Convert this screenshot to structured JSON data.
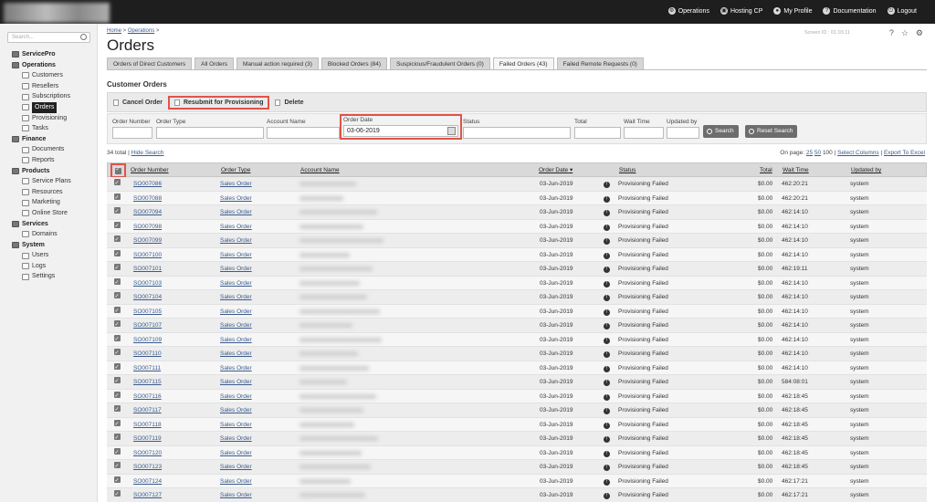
{
  "topnav": [
    {
      "label": "Operations",
      "icon": "operations-icon"
    },
    {
      "label": "Hosting CP",
      "icon": "hosting-cp-icon"
    },
    {
      "label": "My Profile",
      "icon": "profile-icon"
    },
    {
      "label": "Documentation",
      "icon": "help-icon"
    },
    {
      "label": "Logout",
      "icon": "power-icon"
    }
  ],
  "sidebar": {
    "search_placeholder": "Search...",
    "root": "ServicePro",
    "groups": [
      {
        "label": "Operations",
        "children": [
          "Customers",
          "Resellers",
          "Subscriptions",
          "Orders",
          "Provisioning",
          "Tasks"
        ]
      },
      {
        "label": "Finance",
        "children": [
          "Documents",
          "Reports"
        ]
      },
      {
        "label": "Products",
        "children": [
          "Service Plans",
          "Resources",
          "Marketing",
          "Online Store"
        ]
      },
      {
        "label": "Services",
        "children": [
          "Domains"
        ]
      },
      {
        "label": "System",
        "children": [
          "Users",
          "Logs",
          "Settings"
        ]
      }
    ],
    "active": "Orders"
  },
  "breadcrumb": {
    "home": "Home",
    "sep": " > ",
    "section": "Operations",
    "tail": " >"
  },
  "page": {
    "title": "Orders",
    "screen_id": "Screen ID : 01.03.11"
  },
  "tabs": [
    "Orders of Direct Customers",
    "All Orders",
    "Manual action required (3)",
    "Blocked Orders (84)",
    "Suspicious/Fraudulent Orders (0)",
    "Failed Orders (43)",
    "Failed Remote Requests (0)"
  ],
  "active_tab": "Failed Orders (43)",
  "section_title": "Customer Orders",
  "actions": {
    "cancel": "Cancel Order",
    "resubmit": "Resubmit for Provisioning",
    "delete": "Delete"
  },
  "filters": {
    "order_number": "Order Number",
    "order_type": "Order Type",
    "account_name": "Account Name",
    "order_date": "Order Date",
    "order_date_value": "03-06-2019",
    "status": "Status",
    "total": "Total",
    "wait_time": "Wait Time",
    "updated_by": "Updated by",
    "search_btn": "Search",
    "reset_btn": "Reset Search"
  },
  "listing": {
    "total": "34 total",
    "sep": " | ",
    "hide_search": "Hide Search",
    "on_page": "On page:",
    "page_25": "25",
    "page_50": "50",
    "page_100": "100",
    "select_columns": "Select Columns",
    "export": "Export To Excel"
  },
  "columns": {
    "order_number": "Order Number",
    "order_type": "Order Type",
    "account_name": "Account Name",
    "order_date": "Order Date",
    "status": "Status",
    "total": "Total",
    "wait_time": "Wait Time",
    "updated_by": "Updated by"
  },
  "rows": [
    {
      "number": "SO007086",
      "type": "Sales Order",
      "date": "03-Jun-2019",
      "status": "Provisioning Failed",
      "total": "$0.00",
      "wait": "462:20:21",
      "by": "system"
    },
    {
      "number": "SO007088",
      "type": "Sales Order",
      "date": "03-Jun-2019",
      "status": "Provisioning Failed",
      "total": "$0.00",
      "wait": "462:20:21",
      "by": "system"
    },
    {
      "number": "SO007094",
      "type": "Sales Order",
      "date": "03-Jun-2019",
      "status": "Provisioning Failed",
      "total": "$0.00",
      "wait": "462:14:10",
      "by": "system"
    },
    {
      "number": "SO007098",
      "type": "Sales Order",
      "date": "03-Jun-2019",
      "status": "Provisioning Failed",
      "total": "$0.00",
      "wait": "462:14:10",
      "by": "system"
    },
    {
      "number": "SO007099",
      "type": "Sales Order",
      "date": "03-Jun-2019",
      "status": "Provisioning Failed",
      "total": "$0.00",
      "wait": "462:14:10",
      "by": "system"
    },
    {
      "number": "SO007100",
      "type": "Sales Order",
      "date": "03-Jun-2019",
      "status": "Provisioning Failed",
      "total": "$0.00",
      "wait": "462:14:10",
      "by": "system"
    },
    {
      "number": "SO007101",
      "type": "Sales Order",
      "date": "03-Jun-2019",
      "status": "Provisioning Failed",
      "total": "$0.00",
      "wait": "462:19:11",
      "by": "system"
    },
    {
      "number": "SO007103",
      "type": "Sales Order",
      "date": "03-Jun-2019",
      "status": "Provisioning Failed",
      "total": "$0.00",
      "wait": "462:14:10",
      "by": "system"
    },
    {
      "number": "SO007104",
      "type": "Sales Order",
      "date": "03-Jun-2019",
      "status": "Provisioning Failed",
      "total": "$0.00",
      "wait": "462:14:10",
      "by": "system"
    },
    {
      "number": "SO007105",
      "type": "Sales Order",
      "date": "03-Jun-2019",
      "status": "Provisioning Failed",
      "total": "$0.00",
      "wait": "462:14:10",
      "by": "system"
    },
    {
      "number": "SO007107",
      "type": "Sales Order",
      "date": "03-Jun-2019",
      "status": "Provisioning Failed",
      "total": "$0.00",
      "wait": "462:14:10",
      "by": "system"
    },
    {
      "number": "SO007109",
      "type": "Sales Order",
      "date": "03-Jun-2019",
      "status": "Provisioning Failed",
      "total": "$0.00",
      "wait": "462:14:10",
      "by": "system"
    },
    {
      "number": "SO007110",
      "type": "Sales Order",
      "date": "03-Jun-2019",
      "status": "Provisioning Failed",
      "total": "$0.00",
      "wait": "462:14:10",
      "by": "system"
    },
    {
      "number": "SO007111",
      "type": "Sales Order",
      "date": "03-Jun-2019",
      "status": "Provisioning Failed",
      "total": "$0.00",
      "wait": "462:14:10",
      "by": "system"
    },
    {
      "number": "SO007115",
      "type": "Sales Order",
      "date": "03-Jun-2019",
      "status": "Provisioning Failed",
      "total": "$0.00",
      "wait": "584:08:01",
      "by": "system"
    },
    {
      "number": "SO007116",
      "type": "Sales Order",
      "date": "03-Jun-2019",
      "status": "Provisioning Failed",
      "total": "$0.00",
      "wait": "462:18:45",
      "by": "system"
    },
    {
      "number": "SO007117",
      "type": "Sales Order",
      "date": "03-Jun-2019",
      "status": "Provisioning Failed",
      "total": "$0.00",
      "wait": "462:18:45",
      "by": "system"
    },
    {
      "number": "SO007118",
      "type": "Sales Order",
      "date": "03-Jun-2019",
      "status": "Provisioning Failed",
      "total": "$0.00",
      "wait": "462:18:45",
      "by": "system"
    },
    {
      "number": "SO007119",
      "type": "Sales Order",
      "date": "03-Jun-2019",
      "status": "Provisioning Failed",
      "total": "$0.00",
      "wait": "462:18:45",
      "by": "system"
    },
    {
      "number": "SO007120",
      "type": "Sales Order",
      "date": "03-Jun-2019",
      "status": "Provisioning Failed",
      "total": "$0.00",
      "wait": "462:18:45",
      "by": "system"
    },
    {
      "number": "SO007123",
      "type": "Sales Order",
      "date": "03-Jun-2019",
      "status": "Provisioning Failed",
      "total": "$0.00",
      "wait": "462:18:45",
      "by": "system"
    },
    {
      "number": "SO007124",
      "type": "Sales Order",
      "date": "03-Jun-2019",
      "status": "Provisioning Failed",
      "total": "$0.00",
      "wait": "462:17:21",
      "by": "system"
    },
    {
      "number": "SO007127",
      "type": "Sales Order",
      "date": "03-Jun-2019",
      "status": "Provisioning Failed",
      "total": "$0.00",
      "wait": "462:17:21",
      "by": "system"
    }
  ],
  "colors": {
    "highlight": "#e0534a",
    "link": "#3a5b8c",
    "topbar": "#1e1e1e"
  }
}
